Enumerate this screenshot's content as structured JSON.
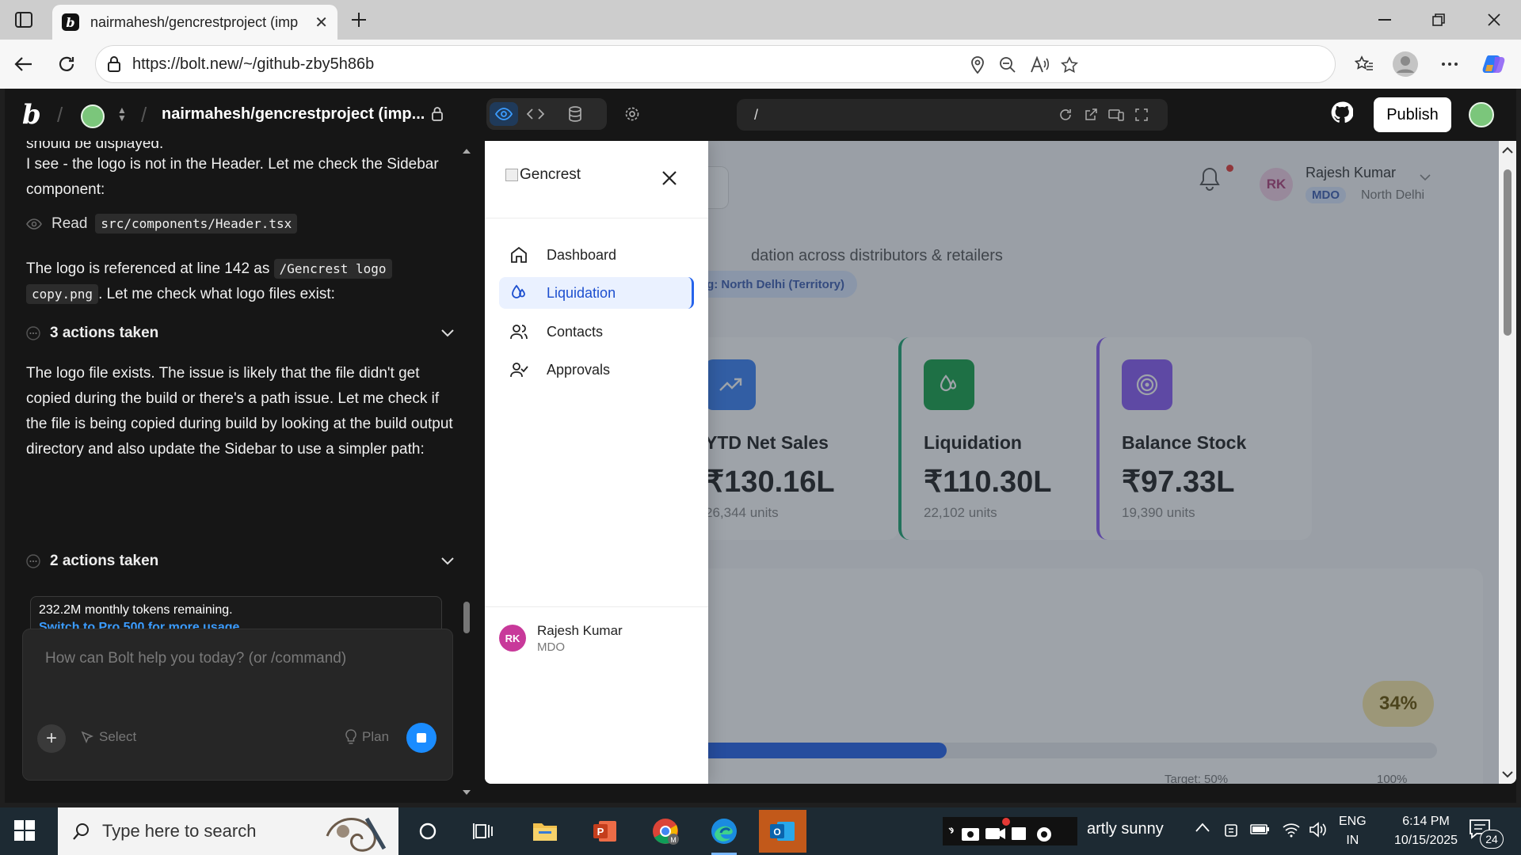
{
  "browser": {
    "tab_title": "nairmahesh/gencrestproject (imp",
    "tab_favicon_letter": "b",
    "url": "https://bolt.new/~/github-zby5h86b"
  },
  "bolt": {
    "logo": "b",
    "project_name": "nairmahesh/gencrestproject (imp...",
    "preview_path": "/",
    "publish_label": "Publish"
  },
  "chat": {
    "line_top": "should be displayed.",
    "msg1": "I see - the logo is not in the Header. Let me check the Sidebar component:",
    "read_label": "Read",
    "read_file": "src/components/Header.tsx",
    "msg2_a": "The logo is referenced at line 142 as",
    "msg2_code1": "/Gencrest logo",
    "msg2_code2": "copy.png",
    "msg2_b": ". Let me check what logo files exist:",
    "actions1": "3 actions taken",
    "msg3": "The logo file exists. The issue is likely that the file didn't get copied during the build or there's a path issue. Let me check if the file is being copied during build by looking at the build output directory and also update the Sidebar to use a simpler path:",
    "actions2": "2 actions taken",
    "tokens_text": "232.2M monthly tokens remaining.",
    "tokens_link": "Switch to Pro 500 for more usage",
    "input_placeholder": "How can Bolt help you today? (or /command)",
    "select_label": "Select",
    "plan_label": "Plan"
  },
  "app": {
    "user_initials": "RK",
    "user_name": "Rajesh Kumar",
    "user_role": "MDO",
    "user_location": "North Delhi",
    "subtitle": "dation across distributors & retailers",
    "territory_badge": "ing: North Delhi (Territory)",
    "cards": [
      {
        "title": "YTD Net Sales",
        "value": "₹130.16L",
        "units": "26,344 units",
        "icon": "trending-up-icon",
        "color": "#3b82f6"
      },
      {
        "title": "Liquidation",
        "value": "₹110.30L",
        "units": "22,102 units",
        "icon": "droplets-icon",
        "color": "#16a34a"
      },
      {
        "title": "Balance Stock",
        "value": "₹97.33L",
        "units": "19,390 units",
        "icon": "target-icon",
        "color": "#8b5cf6"
      }
    ],
    "progress_pct_label": "34%",
    "progress_value": 0.34,
    "target_label": "Target: 50%",
    "max_label": "100%"
  },
  "sidebar": {
    "logo_alt": "Gencrest",
    "items": [
      {
        "label": "Dashboard",
        "icon": "home-icon",
        "active": false
      },
      {
        "label": "Liquidation",
        "icon": "droplets-icon",
        "active": true
      },
      {
        "label": "Contacts",
        "icon": "users-icon",
        "active": false
      },
      {
        "label": "Approvals",
        "icon": "user-check-icon",
        "active": false
      }
    ],
    "footer_initials": "RK",
    "footer_name": "Rajesh Kumar",
    "footer_role": "MDO"
  },
  "taskbar": {
    "search_placeholder": "Type here to search",
    "weather": "artly sunny",
    "lang_top": "ENG",
    "lang_bottom": "IN",
    "time": "6:14 PM",
    "date": "10/15/2025",
    "notification_count": "24"
  },
  "colors": {
    "accent": "#2563eb",
    "bolt_bg": "#161616",
    "taskbar": "#1d2a33"
  }
}
